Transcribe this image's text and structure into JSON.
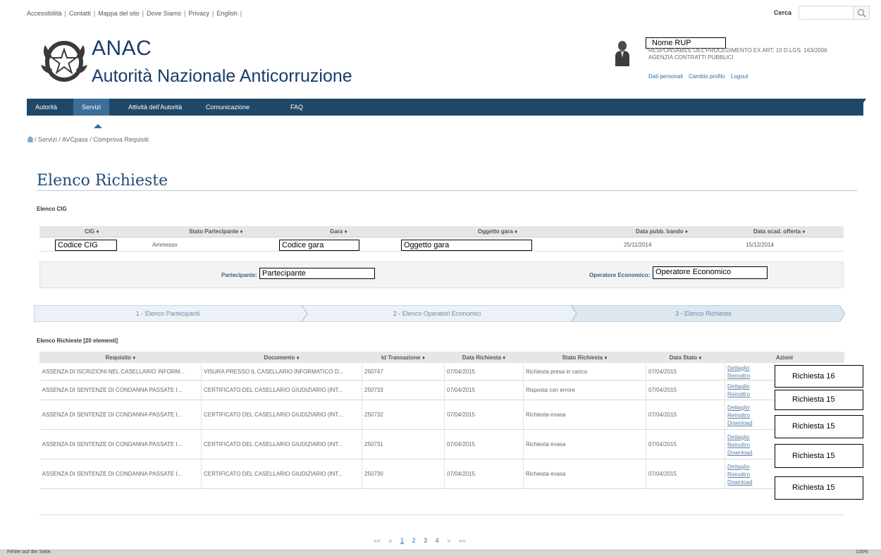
{
  "top_links": [
    "Accessibilità",
    "Contatti",
    "Mappa del sito",
    "Dove Siamo",
    "Privacy",
    "English"
  ],
  "search": {
    "label": "Cerca",
    "value": ""
  },
  "logo": {
    "title": "ANAC",
    "subtitle": "Autorità Nazionale Anticorruzione"
  },
  "user": {
    "name": "Nome RUP",
    "role": "RESPONSABILE DEL PROCEDIMENTO EX ART. 10 D.LGS. 163/2006",
    "org": "AGENZIA CONTRATTI PUBBLICI",
    "links": [
      "Dati personali",
      "Cambio profilo",
      "Logout"
    ]
  },
  "nav": {
    "items": [
      "Autorità",
      "Servizi",
      "Attività dell'Autorità",
      "Comunicazione",
      "FAQ"
    ],
    "active": "Servizi"
  },
  "breadcrumb": "/ Servizi / AVCpass / Comprova Requisiti",
  "page_title": "Elenco Richieste",
  "cig_section": {
    "label": "Elenco CIG",
    "headers": [
      "CIG",
      "Stato Partecipante",
      "Gara",
      "Oggetto gara",
      "Data pubb. bando",
      "Data scad. offerta"
    ],
    "row": {
      "cig": "Codice CIG",
      "stato": "Ammesso",
      "gara": "Codice gara",
      "oggetto": "Oggetto gara",
      "data_pubb": "25/11/2014",
      "data_scad": "15/12/2014"
    }
  },
  "participant": {
    "partecipante_label": "Partecipante",
    "partecipante_value": "Partecipante",
    "operatore_label": "Operatore Economico",
    "operatore_value": "Operatore Economico"
  },
  "steps": [
    "1 - Elenco Partecipanti",
    "2 - Elenco Operatori Economici",
    "3 - Elenco Richieste"
  ],
  "requests": {
    "label": "Elenco Richieste [20 elementi]",
    "headers": [
      "Requisito",
      "Documento",
      "Id Transazione",
      "Data Richiesta",
      "Stato Richiesta",
      "Data Stato",
      "Azioni"
    ],
    "rows": [
      {
        "requisito": "ASSENZA DI ISCRIZIONI NEL CASELLARIO INFORM...",
        "documento": "VISURA PRESSO IL CASELLARIO INFORMATICO D...",
        "id": "250747",
        "data_richiesta": "07/04/2015",
        "stato": "Richiesta presa in carico",
        "data_stato": "07/04/2015",
        "actions": [
          "Dettaglio",
          "Reinoltro"
        ],
        "note": "Richiesta 16"
      },
      {
        "requisito": "ASSENZA DI SENTENZE DI CONDANNA PASSATE I...",
        "documento": "CERTIFICATO DEL CASELLARIO GIUDIZIARIO (INT...",
        "id": "250733",
        "data_richiesta": "07/04/2015",
        "stato": "Risposta con errore",
        "data_stato": "07/04/2015",
        "actions": [
          "Dettaglio",
          "Reinoltro"
        ],
        "note": "Richiesta 15"
      },
      {
        "requisito": "ASSENZA DI SENTENZE DI CONDANNA PASSATE I...",
        "documento": "CERTIFICATO DEL CASELLARIO GIUDIZIARIO (INT...",
        "id": "250732",
        "data_richiesta": "07/04/2015",
        "stato": "Richiesta evasa",
        "data_stato": "07/04/2015",
        "actions": [
          "Dettaglio",
          "Reinoltro",
          "Download"
        ],
        "note": "Richiesta 15"
      },
      {
        "requisito": "ASSENZA DI SENTENZE DI CONDANNA PASSATE I...",
        "documento": "CERTIFICATO DEL CASELLARIO GIUDIZIARIO (INT...",
        "id": "250731",
        "data_richiesta": "07/04/2015",
        "stato": "Richiesta evasa",
        "data_stato": "07/04/2015",
        "actions": [
          "Dettaglio",
          "Reinoltro",
          "Download"
        ],
        "note": "Richiesta 15"
      },
      {
        "requisito": "ASSENZA DI SENTENZE DI CONDANNA PASSATE I...",
        "documento": "CERTIFICATO DEL CASELLARIO GIUDIZIARIO (INT...",
        "id": "250730",
        "data_richiesta": "07/04/2015",
        "stato": "Richiesta evasa",
        "data_stato": "07/04/2015",
        "actions": [
          "Dettaglio",
          "Reinoltro",
          "Download"
        ],
        "note": "Richiesta 15"
      }
    ]
  },
  "pagination": {
    "first": "««",
    "prev": "«",
    "pages": [
      "1",
      "2",
      "3",
      "4"
    ],
    "current": "1",
    "next": "»",
    "last": "»»"
  },
  "statusbar": {
    "left": "Fehler auf der Seite.",
    "right": "100%"
  },
  "colors": {
    "nav": "#1f4868",
    "nav_active": "#3b6f9a",
    "title": "#1f4d78",
    "link": "#2a6fa8"
  }
}
